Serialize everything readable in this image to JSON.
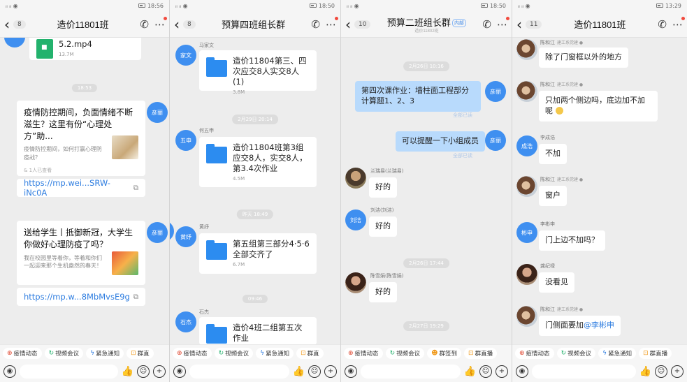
{
  "panels": [
    {
      "status": {
        "carrier": "ᵢₗ ᵢₗ ◎",
        "battery": "18:56"
      },
      "back_count": "8",
      "title": "造价11801班",
      "file": {
        "name": "5.2.mp4",
        "size": "13.7M"
      },
      "time1": "18:53",
      "card1": {
        "title": "疫情防控期间，负面情绪不断滋生？这里有份“心理处方”助...",
        "desc": "疫情防控期间，如何打赢心理防疫战？",
        "foot": "& 1人已查看",
        "url": "https://mp.wei...SRW-iNc0A"
      },
      "avatar1": "彦丽",
      "avatar2": "彦丽",
      "card2": {
        "title": "送给学生丨抵御新冠，大学生你做好心理防疫了吗？",
        "desc": "我在校园里等着你，等着和你们一起迎来那个生机盎然的春天！",
        "url": "https://mp.w...8MbMvsE9g"
      },
      "quick": [
        {
          "icon": "⊕",
          "label": "疫情动态",
          "color": "#e0462f"
        },
        {
          "icon": "↻",
          "label": "视频会议",
          "color": "#23b26d"
        },
        {
          "icon": "ϟ",
          "label": "紧急通知",
          "color": "#2e7de0"
        },
        {
          "icon": "⊡",
          "label": "群直",
          "color": "#f09a1c"
        }
      ]
    },
    {
      "status": {
        "battery": "18:50"
      },
      "back_count": "8",
      "title": "预算四班组长群",
      "sender1": "马家文",
      "avatar1": "家文",
      "file1": {
        "name": "造价11804第三、四次应交8人实交8人 (1)",
        "size": "3.8M"
      },
      "time1": "2月29日 20:14",
      "sender2": "何五申",
      "avatar2": "五申",
      "file2": {
        "name": "造价11804班第3组应交8人，实交8人，第3.4次作业",
        "size": "4.5M"
      },
      "time2": "昨天 18:49",
      "sender3": "黄纾",
      "avatar3": "黄纾",
      "avatar_left": "彦丽",
      "file3": {
        "name": "第五组第三部分4·5·6全部交齐了",
        "size": "6.7M"
      },
      "time3": "09:46",
      "sender4": "石杰",
      "avatar4": "石杰",
      "file4": {
        "name": "造价4班二组第五次作业"
      },
      "quick": [
        {
          "icon": "⊕",
          "label": "疫情动态",
          "color": "#e0462f"
        },
        {
          "icon": "↻",
          "label": "视频会议",
          "color": "#23b26d"
        },
        {
          "icon": "ϟ",
          "label": "紧急通知",
          "color": "#2e7de0"
        },
        {
          "icon": "⊡",
          "label": "群直",
          "color": "#f09a1c"
        }
      ]
    },
    {
      "status": {
        "battery": "18:50"
      },
      "back_count": "10",
      "title": "预算二班组长群",
      "title_tag": "内部",
      "title_sub": "造价11802班",
      "time0": "2月26日 10:16",
      "msg1": "第四次课作业：墙柱面工程部分计算题1、2、3",
      "read1": "全部已读",
      "avatar_me": "彦丽",
      "msg2": "可以提醒一下小组成员",
      "read2": "全部已读",
      "sender1": "兰瑞易(兰瑞易)",
      "msg3": "好的",
      "sender2": "刘洁(刘洁)",
      "avatar2": "刘洁",
      "msg4": "好的",
      "time1": "2月26日 17:44",
      "sender3": "陈雪娟(陈雪娟)",
      "msg5": "好的",
      "time2": "2月27日 19:29",
      "quick": [
        {
          "icon": "⊕",
          "label": "疫情动态",
          "color": "#e0462f"
        },
        {
          "icon": "↻",
          "label": "视频会议",
          "color": "#23b26d"
        },
        {
          "icon": "☻",
          "label": "群签到",
          "color": "#f09a1c"
        },
        {
          "icon": "⊡",
          "label": "群直播",
          "color": "#f09a1c"
        }
      ]
    },
    {
      "status": {
        "battery": "13:29"
      },
      "back_count": "11",
      "title": "造价11801班",
      "msg0": "除了门窗框以外的地方",
      "sender1": "陈和江",
      "role1": "建工系党建 ●",
      "msg1": "只加两个侧边吗，底边加不加呢",
      "sender2": "李成浩",
      "avatar2": "成浩",
      "msg2": "不加",
      "sender3": "陈和江",
      "role3": "建工系党建 ●",
      "msg3": "窗户",
      "sender4": "李彬申",
      "avatar4": "彬申",
      "msg4": "门上边不加吗？",
      "sender5": "龚纪禄",
      "msg5": "没看见",
      "sender6": "陈和江",
      "role6": "建工系党建 ●",
      "msg6_text": "门侧面要加",
      "msg6_mention": "@李彬申",
      "quick": [
        {
          "icon": "⊕",
          "label": "疫情动态",
          "color": "#e0462f"
        },
        {
          "icon": "↻",
          "label": "视频会议",
          "color": "#23b26d"
        },
        {
          "icon": "ϟ",
          "label": "紧急通知",
          "color": "#2e7de0"
        },
        {
          "icon": "⊡",
          "label": "群直播",
          "color": "#f09a1c"
        }
      ]
    }
  ],
  "colors": {
    "accent_blue": "#3f8ff0",
    "bubble_blue": "#b8dafc",
    "link_blue": "#2e7de0"
  }
}
